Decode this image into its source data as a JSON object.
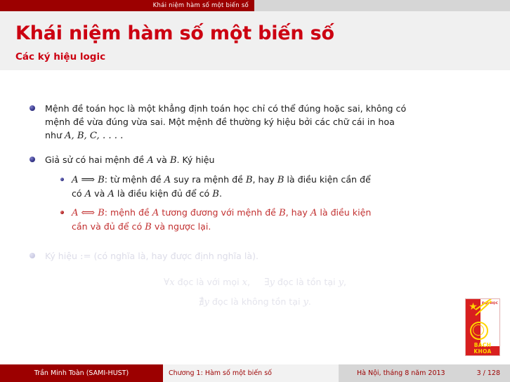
{
  "navbar": {
    "active_section": "Khái niệm hàm số một biến số"
  },
  "title_block": {
    "title": "Khái niệm hàm số một biến số",
    "subtitle": "Các ký hiệu logic"
  },
  "content": {
    "item1": {
      "line1": "Mệnh đề toán học là một khẳng định toán học chỉ có thể đúng hoặc sai, không có",
      "line2": "mệnh đề vừa đúng vừa sai. Một mệnh đề thường ký hiệu bởi các chữ cái in hoa",
      "line3_pre": "như ",
      "line3_math": "A, B, C, . . . ."
    },
    "item2": {
      "pre": "Giả sử có hai mệnh đề ",
      "math_a": "A",
      "mid": " và ",
      "math_b": "B",
      "post": ". Ký hiệu"
    },
    "sub1": {
      "math_a": "A",
      "arrow": "⟹",
      "math_b": "B",
      "t1": ": từ mệnh đề ",
      "math_a2": "A",
      "t2": " suy ra mệnh đề ",
      "math_b2": "B",
      "t3": ", hay ",
      "math_b3": "B",
      "t4": " là điều kiện cần để",
      "line2_t1": "có ",
      "line2_a": "A",
      "line2_t2": " và ",
      "line2_a2": "A",
      "line2_t3": " là điều kiện đủ để có ",
      "line2_b": "B",
      "line2_t4": "."
    },
    "sub2": {
      "math_a": "A",
      "arrow": "⟺",
      "math_b": "B",
      "t1": ": mệnh đề ",
      "math_a2": "A",
      "t2": " tương đương với mệnh đề ",
      "math_b2": "B",
      "t3": ", hay ",
      "math_a3": "A",
      "t4": " là điều kiện",
      "line2_t1": "cần và đủ để có ",
      "line2_b": "B",
      "line2_t2": " và ngược lại."
    },
    "item3": {
      "pre": "Ký hiệu ",
      "symbol": ":=",
      "post": " (có nghĩa là, hay được định nghĩa là)."
    },
    "math_line1": {
      "q1": "∀",
      "v1": "x",
      "t1": " đọc là với mọi ",
      "v2": "x",
      "t2": ",",
      "q2": "∃",
      "v3": "y",
      "t3": " đọc là tồn tại ",
      "v4": "y",
      "t4": ","
    },
    "math_line2": {
      "q1": "∄",
      "v1": "y",
      "t1": " đọc là không tồn tại ",
      "v2": "y",
      "t2": "."
    }
  },
  "logo": {
    "star": "★",
    "top_text": "ĐẠI HỌC",
    "band_text": "BÁCH KHOA"
  },
  "footer": {
    "author": "Trần Minh Toàn (SAMI-HUST)",
    "chapter": "Chương 1: Hàm số một biến số",
    "date": "Hà Nội, tháng 8 năm 2013",
    "page": "3 / 128"
  },
  "colors": {
    "dark_red": "#9c0000",
    "bright_red": "#cc0011",
    "nav_gray": "#d6d6d6",
    "title_bg": "#f0f0f0",
    "bullet_blue": "#3b3b8f",
    "highlight_red": "#c23030",
    "logo_red": "#d81f1f",
    "logo_yellow": "#ffd400"
  }
}
